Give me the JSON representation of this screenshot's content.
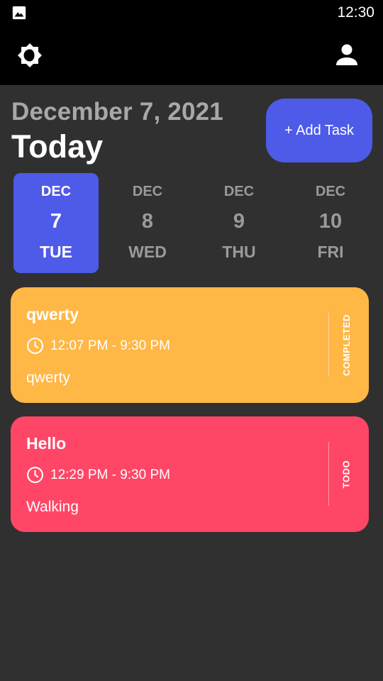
{
  "status_bar": {
    "time": "12:30",
    "notification_icon": "image-icon"
  },
  "app_bar": {
    "theme_icon": "brightness-icon",
    "profile_icon": "person-icon"
  },
  "header": {
    "date": "December 7, 2021",
    "title": "Today",
    "add_task_label": "+ Add Task"
  },
  "date_strip": {
    "items": [
      {
        "month": "DEC",
        "day": "7",
        "weekday": "TUE",
        "selected": true
      },
      {
        "month": "DEC",
        "day": "8",
        "weekday": "WED",
        "selected": false
      },
      {
        "month": "DEC",
        "day": "9",
        "weekday": "THU",
        "selected": false
      },
      {
        "month": "DEC",
        "day": "10",
        "weekday": "FRI",
        "selected": false
      }
    ]
  },
  "tasks": [
    {
      "title": "qwerty",
      "time": "12:07 PM - 9:30 PM",
      "note": "qwerty",
      "status": "COMPLETED",
      "color": "#ffb746"
    },
    {
      "title": "Hello",
      "time": "12:29 PM - 9:30 PM",
      "note": "Walking",
      "status": "TODO",
      "color": "#ff4667"
    }
  ],
  "colors": {
    "accent": "#4e5ae8",
    "background": "#303030"
  }
}
